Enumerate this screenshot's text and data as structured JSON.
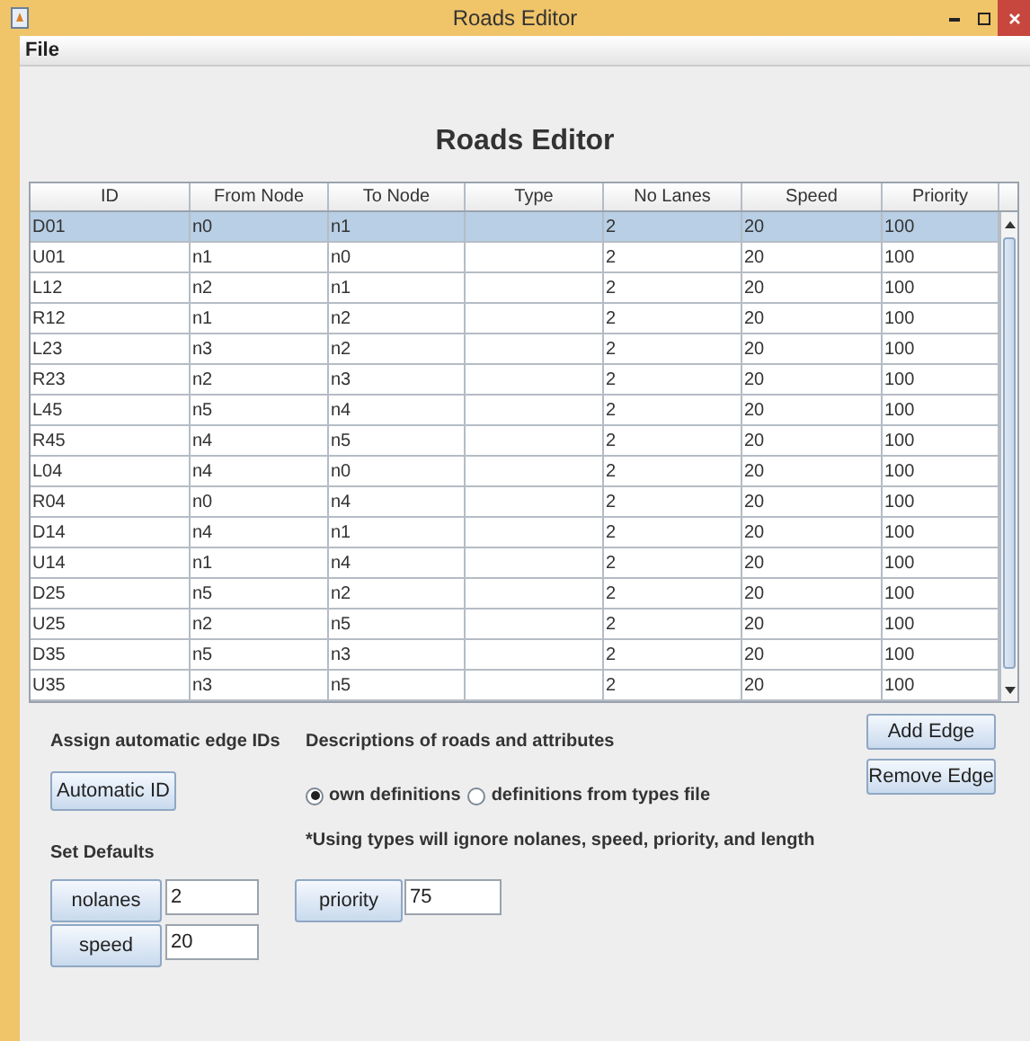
{
  "window": {
    "title": "Roads Editor"
  },
  "menu": [
    "File"
  ],
  "heading": "Roads Editor",
  "table": {
    "columns": [
      "ID",
      "From Node",
      "To Node",
      "Type",
      "No Lanes",
      "Speed",
      "Priority"
    ],
    "rows": [
      {
        "cells": [
          "D01",
          "n0",
          "n1",
          "",
          "2",
          "20",
          "100"
        ],
        "selected": true
      },
      {
        "cells": [
          "U01",
          "n1",
          "n0",
          "",
          "2",
          "20",
          "100"
        ],
        "selected": false
      },
      {
        "cells": [
          "L12",
          "n2",
          "n1",
          "",
          "2",
          "20",
          "100"
        ],
        "selected": false
      },
      {
        "cells": [
          "R12",
          "n1",
          "n2",
          "",
          "2",
          "20",
          "100"
        ],
        "selected": false
      },
      {
        "cells": [
          "L23",
          "n3",
          "n2",
          "",
          "2",
          "20",
          "100"
        ],
        "selected": false
      },
      {
        "cells": [
          "R23",
          "n2",
          "n3",
          "",
          "2",
          "20",
          "100"
        ],
        "selected": false
      },
      {
        "cells": [
          "L45",
          "n5",
          "n4",
          "",
          "2",
          "20",
          "100"
        ],
        "selected": false
      },
      {
        "cells": [
          "R45",
          "n4",
          "n5",
          "",
          "2",
          "20",
          "100"
        ],
        "selected": false
      },
      {
        "cells": [
          "L04",
          "n4",
          "n0",
          "",
          "2",
          "20",
          "100"
        ],
        "selected": false
      },
      {
        "cells": [
          "R04",
          "n0",
          "n4",
          "",
          "2",
          "20",
          "100"
        ],
        "selected": false
      },
      {
        "cells": [
          "D14",
          "n4",
          "n1",
          "",
          "2",
          "20",
          "100"
        ],
        "selected": false
      },
      {
        "cells": [
          "U14",
          "n1",
          "n4",
          "",
          "2",
          "20",
          "100"
        ],
        "selected": false
      },
      {
        "cells": [
          "D25",
          "n5",
          "n2",
          "",
          "2",
          "20",
          "100"
        ],
        "selected": false
      },
      {
        "cells": [
          "U25",
          "n2",
          "n5",
          "",
          "2",
          "20",
          "100"
        ],
        "selected": false
      },
      {
        "cells": [
          "D35",
          "n5",
          "n3",
          "",
          "2",
          "20",
          "100"
        ],
        "selected": false
      },
      {
        "cells": [
          "U35",
          "n3",
          "n5",
          "",
          "2",
          "20",
          "100"
        ],
        "selected": false
      }
    ]
  },
  "auto_id": {
    "label": "Assign automatic edge IDs",
    "button": "Automatic ID"
  },
  "defaults": {
    "label": "Set Defaults",
    "fields": [
      {
        "button": "nolanes",
        "value": "2"
      },
      {
        "button": "speed",
        "value": "20"
      },
      {
        "button": "priority",
        "value": "75"
      }
    ]
  },
  "descriptions": {
    "label": "Descriptions of roads and attributes",
    "options": [
      {
        "label": "own definitions",
        "selected": true
      },
      {
        "label": "definitions from types file",
        "selected": false
      }
    ],
    "note": "*Using types will ignore nolanes, speed, priority, and length"
  },
  "edge_buttons": [
    "Add Edge",
    "Remove Edge"
  ]
}
